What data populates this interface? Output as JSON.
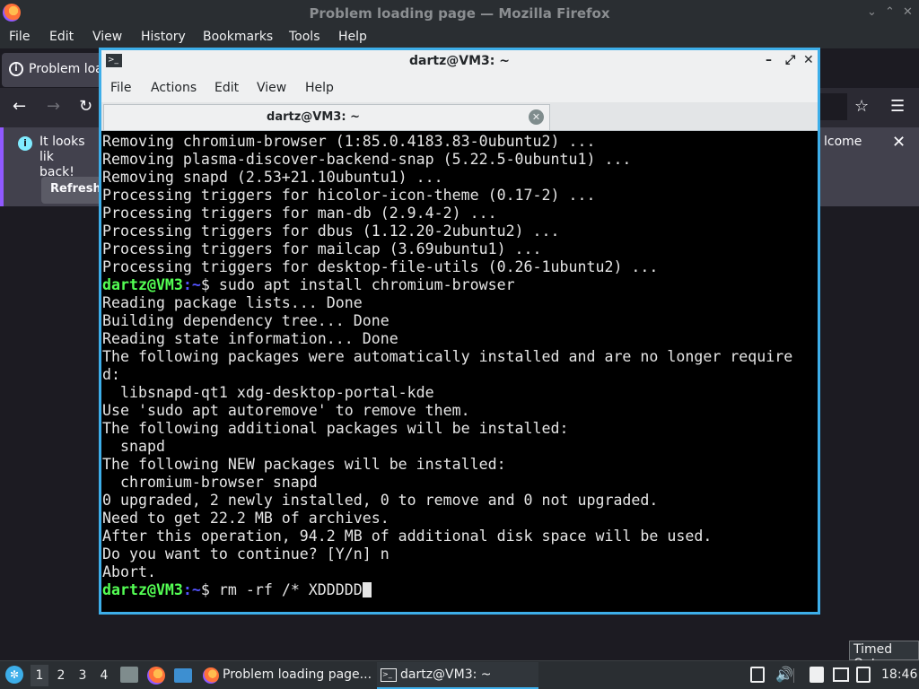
{
  "firefox": {
    "window_title": "Problem loading page — Mozilla Firefox",
    "menu": [
      "File",
      "Edit",
      "View",
      "History",
      "Bookmarks",
      "Tools",
      "Help"
    ],
    "tab_label": "Problem loa",
    "info_bar": {
      "text": "It looks lik back!",
      "text_line1": "It looks lik",
      "text_line2": "back!",
      "refresh_label": "Refresh",
      "right_text": "lcome"
    }
  },
  "terminal": {
    "window_title": "dartz@VM3: ~",
    "menu": [
      "File",
      "Actions",
      "Edit",
      "View",
      "Help"
    ],
    "tab_label": "dartz@VM3: ~",
    "prompt_user": "dartz@VM3",
    "prompt_path": ":~",
    "prompt_symbol": "$",
    "lines": [
      {
        "type": "out",
        "text": "Removing chromium-browser (1:85.0.4183.83-0ubuntu2) ..."
      },
      {
        "type": "out",
        "text": "Removing plasma-discover-backend-snap (5.22.5-0ubuntu1) ..."
      },
      {
        "type": "out",
        "text": "Removing snapd (2.53+21.10ubuntu1) ..."
      },
      {
        "type": "out",
        "text": "Processing triggers for hicolor-icon-theme (0.17-2) ..."
      },
      {
        "type": "out",
        "text": "Processing triggers for man-db (2.9.4-2) ..."
      },
      {
        "type": "out",
        "text": "Processing triggers for dbus (1.12.20-2ubuntu2) ..."
      },
      {
        "type": "out",
        "text": "Processing triggers for mailcap (3.69ubuntu1) ..."
      },
      {
        "type": "out",
        "text": "Processing triggers for desktop-file-utils (0.26-1ubuntu2) ..."
      },
      {
        "type": "cmd",
        "text": " sudo apt install chromium-browser"
      },
      {
        "type": "out",
        "text": "Reading package lists... Done"
      },
      {
        "type": "out",
        "text": "Building dependency tree... Done"
      },
      {
        "type": "out",
        "text": "Reading state information... Done"
      },
      {
        "type": "out",
        "text": "The following packages were automatically installed and are no longer require"
      },
      {
        "type": "out",
        "text": "d:"
      },
      {
        "type": "out",
        "text": "  libsnapd-qt1 xdg-desktop-portal-kde"
      },
      {
        "type": "out",
        "text": "Use 'sudo apt autoremove' to remove them."
      },
      {
        "type": "out",
        "text": "The following additional packages will be installed:"
      },
      {
        "type": "out",
        "text": "  snapd"
      },
      {
        "type": "out",
        "text": "The following NEW packages will be installed:"
      },
      {
        "type": "out",
        "text": "  chromium-browser snapd"
      },
      {
        "type": "out",
        "text": "0 upgraded, 2 newly installed, 0 to remove and 0 not upgraded."
      },
      {
        "type": "out",
        "text": "Need to get 22.2 MB of archives."
      },
      {
        "type": "out",
        "text": "After this operation, 94.2 MB of additional disk space will be used."
      },
      {
        "type": "out",
        "text": "Do you want to continue? [Y/n] n"
      },
      {
        "type": "out",
        "text": "Abort."
      },
      {
        "type": "cmd",
        "text": " rm -rf /* XDDDDD",
        "cursor": true
      }
    ]
  },
  "tooltip": "Timed Out",
  "taskbar": {
    "desktops": [
      "1",
      "2",
      "3",
      "4"
    ],
    "active_desktop": "1",
    "tasks": [
      {
        "label": "Problem loading page...",
        "icon": "firefox-icon",
        "active": false
      },
      {
        "label": "dartz@VM3: ~",
        "icon": "terminal-icon",
        "active": true
      }
    ],
    "clock": "18:46"
  },
  "colors": {
    "accent": "#3daee9",
    "prompt_user": "#54ff54",
    "prompt_path": "#5454ff",
    "terminal_bg": "#000000",
    "info_accent": "#9059ff"
  }
}
